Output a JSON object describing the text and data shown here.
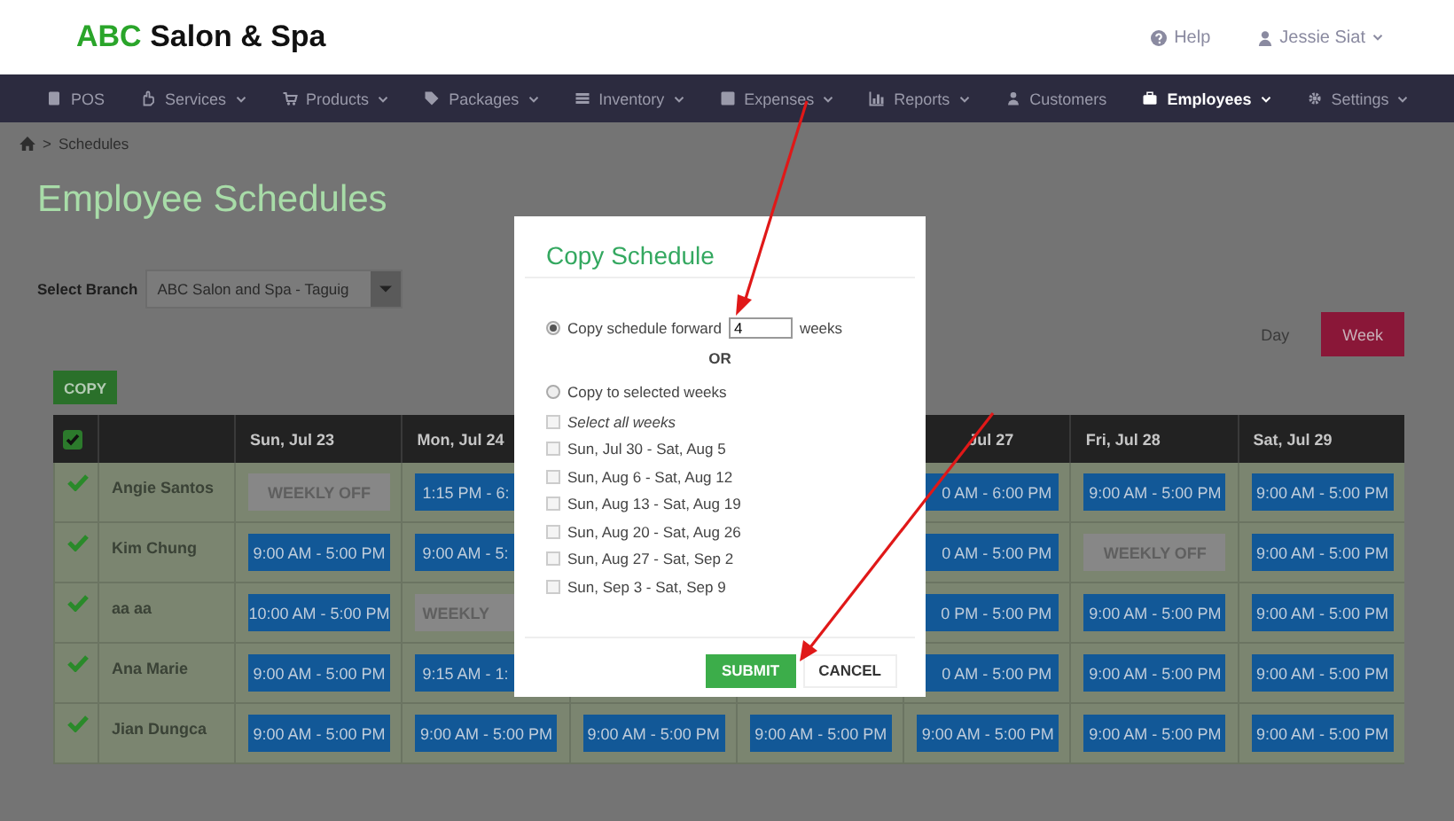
{
  "header": {
    "logo": {
      "accent": "ABC",
      "rest": "Salon & Spa"
    },
    "help": "Help",
    "user": "Jessie Siat"
  },
  "nav": [
    {
      "label": "POS",
      "has_menu": false,
      "selected": false
    },
    {
      "label": "Services",
      "has_menu": true,
      "selected": false
    },
    {
      "label": "Products",
      "has_menu": true,
      "selected": false
    },
    {
      "label": "Packages",
      "has_menu": true,
      "selected": false
    },
    {
      "label": "Inventory",
      "has_menu": true,
      "selected": false
    },
    {
      "label": "Expenses",
      "has_menu": true,
      "selected": false
    },
    {
      "label": "Reports",
      "has_menu": true,
      "selected": false
    },
    {
      "label": "Customers",
      "has_menu": false,
      "selected": false
    },
    {
      "label": "Employees",
      "has_menu": true,
      "selected": true
    },
    {
      "label": "Settings",
      "has_menu": true,
      "selected": false
    }
  ],
  "breadcrumb": {
    "separator": ">",
    "items": [
      "Schedules"
    ]
  },
  "page_title": "Employee Schedules",
  "branch": {
    "label": "Select Branch",
    "value": "ABC Salon and Spa - Taguig"
  },
  "views": [
    {
      "label": "Day",
      "selected": false
    },
    {
      "label": "Week",
      "selected": true
    }
  ],
  "copy_button": "COPY",
  "table": {
    "all_checked": true,
    "columns": [
      {
        "label": "Sun, Jul 23"
      },
      {
        "label": "Mon, Jul 24"
      },
      {
        "label": "Jul 27"
      },
      {
        "label": "Fri, Jul 28"
      },
      {
        "label": "Sat, Jul 29"
      }
    ],
    "rows": [
      {
        "name": "Angie Santos",
        "checked": true,
        "shifts": [
          {
            "kind": "off",
            "text": "WEEKLY OFF"
          },
          {
            "kind": "shift",
            "text": "1:15 PM - 6:"
          },
          {
            "kind": "shift",
            "text": "0 AM - 6:00 PM"
          },
          {
            "kind": "shift",
            "text": "9:00 AM - 5:00 PM"
          },
          {
            "kind": "shift",
            "text": "9:00 AM - 5:00 PM"
          }
        ]
      },
      {
        "name": "Kim Chung",
        "checked": true,
        "shifts": [
          {
            "kind": "shift",
            "text": "9:00 AM - 5:00 PM"
          },
          {
            "kind": "shift",
            "text": "9:00 AM - 5:"
          },
          {
            "kind": "shift",
            "text": "0 AM - 5:00 PM"
          },
          {
            "kind": "off",
            "text": "WEEKLY OFF"
          },
          {
            "kind": "shift",
            "text": "9:00 AM - 5:00 PM"
          }
        ]
      },
      {
        "name": "aa aa",
        "checked": true,
        "shifts": [
          {
            "kind": "shift",
            "text": "10:00 AM - 5:00 PM"
          },
          {
            "kind": "off",
            "text": "WEEKLY"
          },
          {
            "kind": "shift",
            "text": "0 PM - 5:00 PM"
          },
          {
            "kind": "shift",
            "text": "9:00 AM - 5:00 PM"
          },
          {
            "kind": "shift",
            "text": "9:00 AM - 5:00 PM"
          }
        ]
      },
      {
        "name": "Ana Marie",
        "checked": true,
        "shifts": [
          {
            "kind": "shift",
            "text": "9:00 AM - 5:00 PM"
          },
          {
            "kind": "shift",
            "text": "9:15 AM - 1:"
          },
          {
            "kind": "shift",
            "text": "0 AM - 5:00 PM"
          },
          {
            "kind": "shift",
            "text": "9:00 AM - 5:00 PM"
          },
          {
            "kind": "shift",
            "text": "9:00 AM - 5:00 PM"
          }
        ]
      },
      {
        "name": "Jian Dungca",
        "checked": true,
        "shifts": [
          {
            "kind": "shift",
            "text": "9:00 AM - 5:00 PM"
          },
          {
            "kind": "shift",
            "text": "9:00 AM - 5:00 PM"
          },
          {
            "kind": "shift",
            "text": "9:00 AM - 5:00 PM"
          },
          {
            "kind": "shift",
            "text": "9:00 AM - 5:00 PM"
          },
          {
            "kind": "shift",
            "text": "9:00 AM - 5:00 PM"
          },
          {
            "kind": "shift",
            "text": "9:00 AM - 5:00 PM"
          },
          {
            "kind": "shift",
            "text": "9:00 AM - 5:00 PM"
          }
        ]
      }
    ]
  },
  "modal": {
    "title": "Copy Schedule",
    "options": [
      {
        "kind": "forward",
        "label": "Copy schedule forward",
        "value": "4",
        "unit": "weeks",
        "selected": true
      },
      {
        "kind": "weeks",
        "label": "Copy to selected weeks",
        "selected": false
      }
    ],
    "separator": "OR",
    "select_all": {
      "label": "Select all weeks",
      "checked": false
    },
    "weeks": [
      {
        "label": "Sun, Jul 30 - Sat, Aug 5",
        "checked": false
      },
      {
        "label": "Sun, Aug 6 - Sat, Aug 12",
        "checked": false
      },
      {
        "label": "Sun, Aug 13 - Sat, Aug 19",
        "checked": false
      },
      {
        "label": "Sun, Aug 20 - Sat, Aug 26",
        "checked": false
      },
      {
        "label": "Sun, Aug 27 - Sat, Sep 2",
        "checked": false
      },
      {
        "label": "Sun, Sep 3 - Sat, Sep 9",
        "checked": false
      }
    ],
    "buttons": [
      {
        "label": "SUBMIT",
        "kind": "primary"
      },
      {
        "label": "CANCEL",
        "kind": "default"
      }
    ]
  }
}
